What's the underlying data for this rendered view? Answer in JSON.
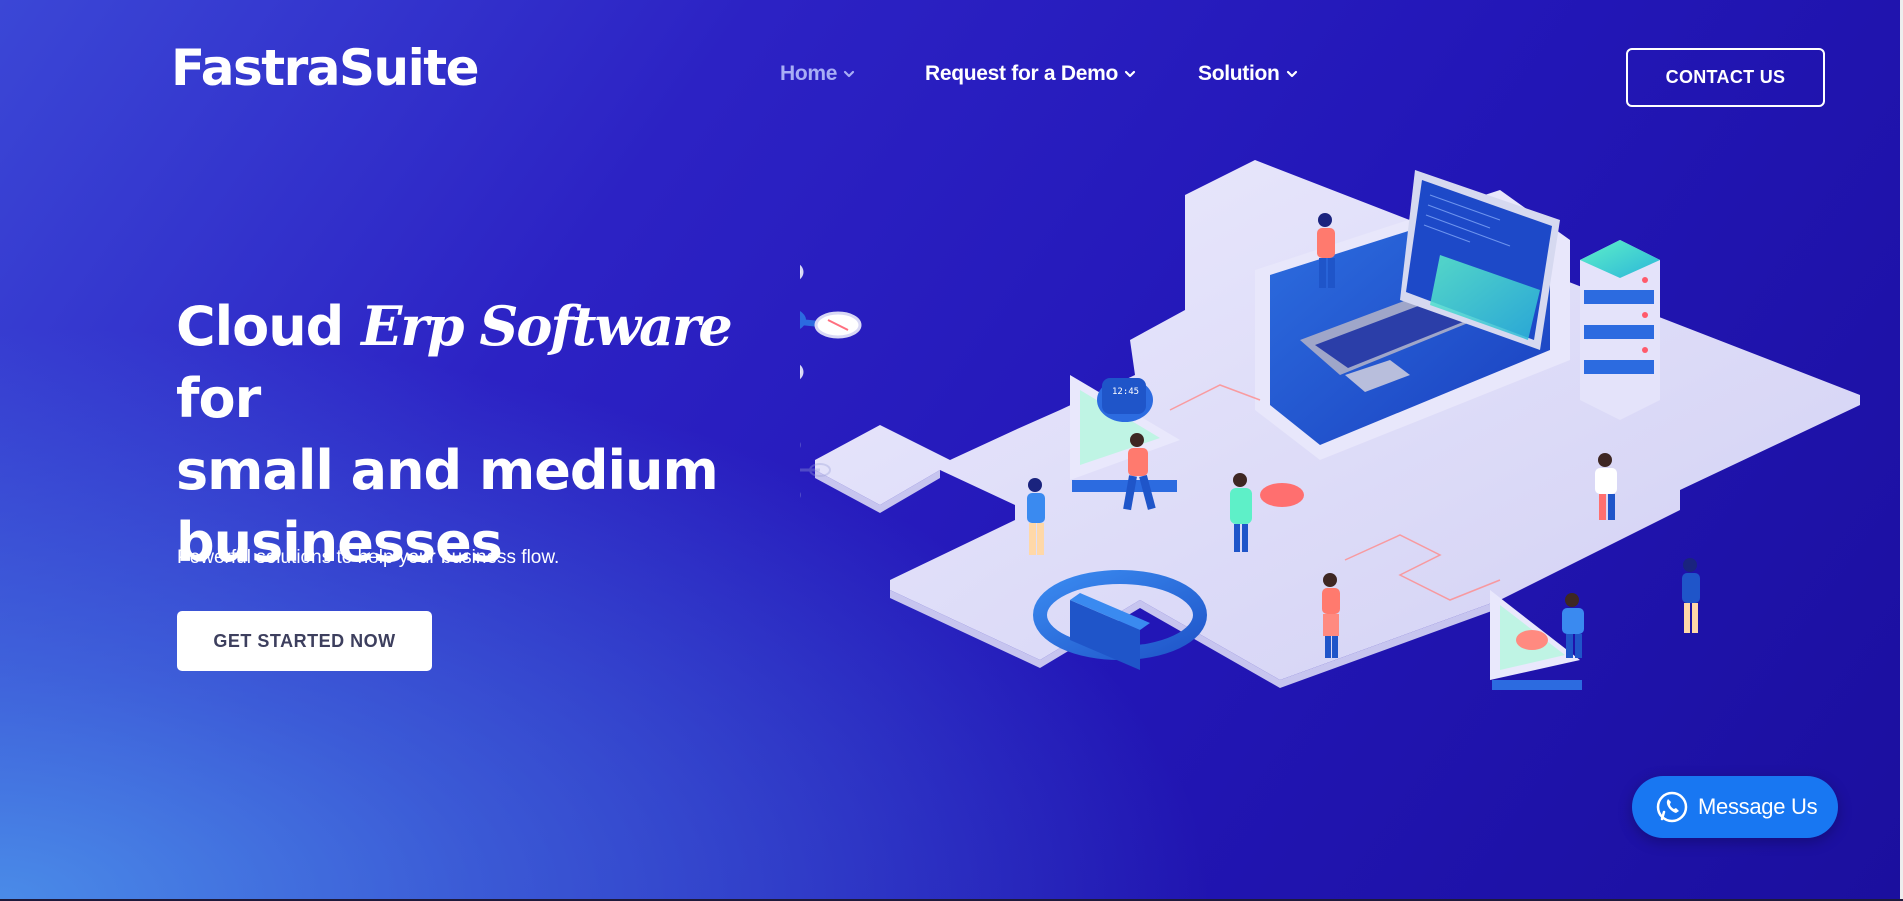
{
  "header": {
    "logo": "FastraSuite",
    "nav": [
      {
        "label": "Home",
        "active": true
      },
      {
        "label": "Request for a Demo",
        "active": false
      },
      {
        "label": "Solution",
        "active": false
      }
    ],
    "contact_label": "CONTACT US"
  },
  "hero": {
    "headline_part1": "Cloud",
    "headline_italic": "Erp Software",
    "headline_part2": "for",
    "headline_line2": "small and medium",
    "headline_line3": "businesses",
    "subline": "Powerful solutions to help your business flow.",
    "cta_label": "GET STARTED NOW"
  },
  "illustration": {
    "watch_time": "12:45"
  },
  "floating": {
    "message_label": "Message Us"
  },
  "colors": {
    "background_start": "#3b47d6",
    "background_end": "#1b0f9e",
    "nav_active": "#a8aef5",
    "message_button": "#1877f2",
    "cta_text": "#3d3f5e"
  },
  "icons": {
    "nav_chevron": "chevron-down-icon",
    "message": "whatsapp-icon"
  }
}
